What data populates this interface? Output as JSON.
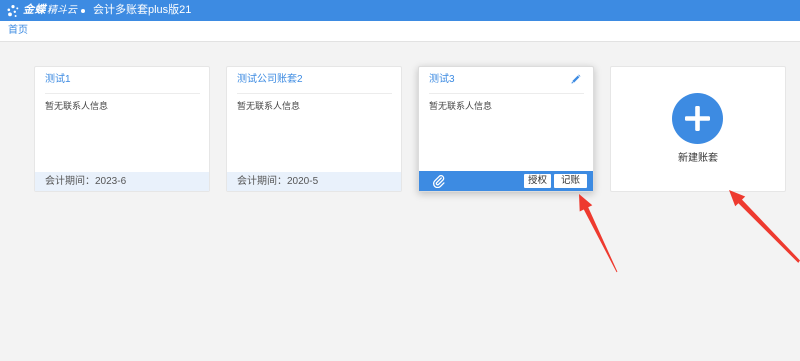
{
  "header": {
    "logo_main": "金蝶",
    "logo_sub": "精斗云",
    "logo_icon": "kingdee-logo-icon",
    "account_set_name": "会计多账套plus版21"
  },
  "breadcrumb": {
    "home": "首页"
  },
  "cards": [
    {
      "title": "测试1",
      "contact": "暂无联系人信息",
      "period": "会计期间：2023-6"
    },
    {
      "title": "测试公司账套2",
      "contact": "暂无联系人信息",
      "period": "会计期间：2020-5"
    },
    {
      "title": "测试3",
      "contact": "暂无联系人信息",
      "icons": {
        "edit": "pencil-icon",
        "attachment": "paperclip-icon"
      },
      "actions": [
        "授权",
        "记账"
      ]
    }
  ],
  "new_card": {
    "label": "新建账套",
    "icon": "plus-icon"
  },
  "colors": {
    "primary": "#3d8be2",
    "page_background": "#f3f3f3",
    "footer_background": "#e9f1fb",
    "annotation": "#ee3a2f"
  }
}
